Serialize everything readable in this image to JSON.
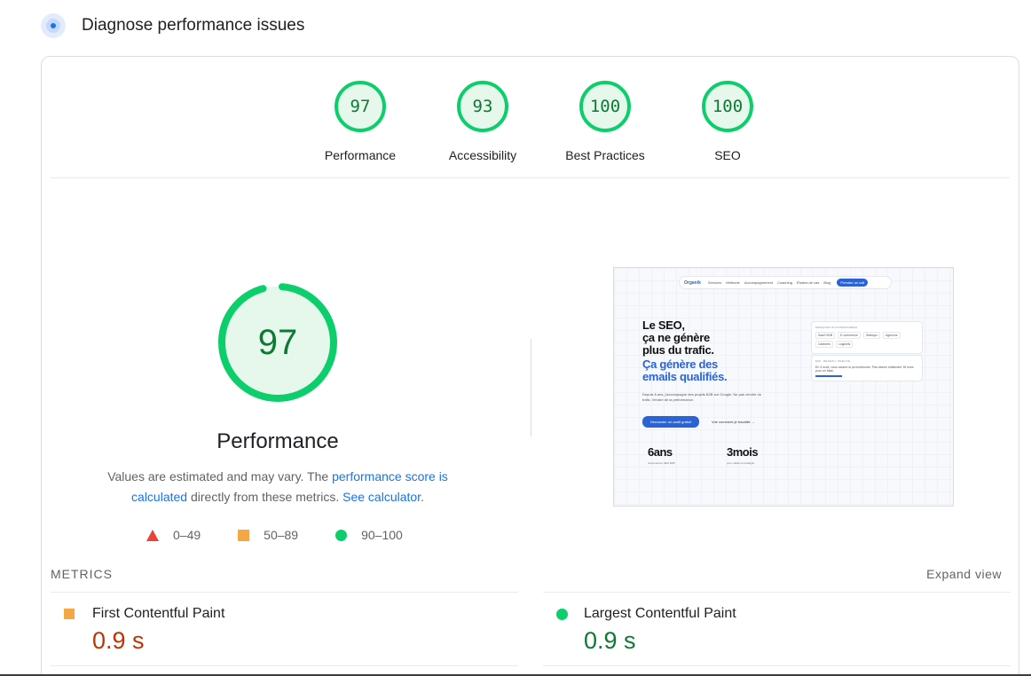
{
  "header": {
    "title": "Diagnose performance issues"
  },
  "gauges": [
    {
      "score": "97",
      "label": "Performance"
    },
    {
      "score": "93",
      "label": "Accessibility"
    },
    {
      "score": "100",
      "label": "Best Practices"
    },
    {
      "score": "100",
      "label": "SEO"
    }
  ],
  "performance": {
    "score": "97",
    "score_fraction": 0.97,
    "title": "Performance",
    "desc_before": "Values are estimated and may vary. The ",
    "desc_link1": "performance score is calculated",
    "desc_middle": " directly from these metrics. ",
    "desc_link2": "See calculator",
    "desc_end": "."
  },
  "legend": {
    "fail": "0–49",
    "average": "50–89",
    "pass": "90–100"
  },
  "thumbnail": {
    "brand": "Organik",
    "nav_links": [
      "Services",
      "Méthode",
      "Accompagnement",
      "Coaching",
      "Études de cas",
      "Blog"
    ],
    "nav_button": "Prendre un call",
    "headline_line1": "Le SEO,",
    "headline_line2": "ça ne génère",
    "headline_line3": "plus du trafic.",
    "headline_blue1": "Ça génère des",
    "headline_blue2": "emails qualifiés.",
    "paragraph": "Depuis 6 ans, j'accompagne des projets B2B sur Google. Ne pas vendre du trafic. Vendre de la performance.",
    "cta_button": "Demander un audit gratuit",
    "cta_link": "Voir comment je travaille →",
    "stat1": "6ans",
    "stat1_sub": "d'expérience SEO B2B",
    "stat2": "3mois",
    "stat2_sub": "pour valider la stratégie",
    "card1_title": "MARQUES ACCOMPAGNÉES",
    "card1_chips": [
      "SaaS B2B",
      "E-commerce",
      "Startups",
      "Agences",
      "Cabinets",
      "Logiciels"
    ],
    "card2_title": "MOI, RÉSEAU, PREUVE",
    "card2_text": "En 3 mois, vous saurez si ça fonctionne. Pas besoin d'attendre 18 mois pour un bilan."
  },
  "metrics": {
    "heading": "METRICS",
    "expand": "Expand view",
    "items": [
      {
        "label": "First Contentful Paint",
        "value": "0.9 s",
        "status": "average"
      },
      {
        "label": "Largest Contentful Paint",
        "value": "0.9 s",
        "status": "pass"
      }
    ]
  },
  "colors": {
    "pass": "#0cce6b",
    "average": "#f4a742",
    "fail": "#eb4335",
    "link": "#1a73e8"
  }
}
